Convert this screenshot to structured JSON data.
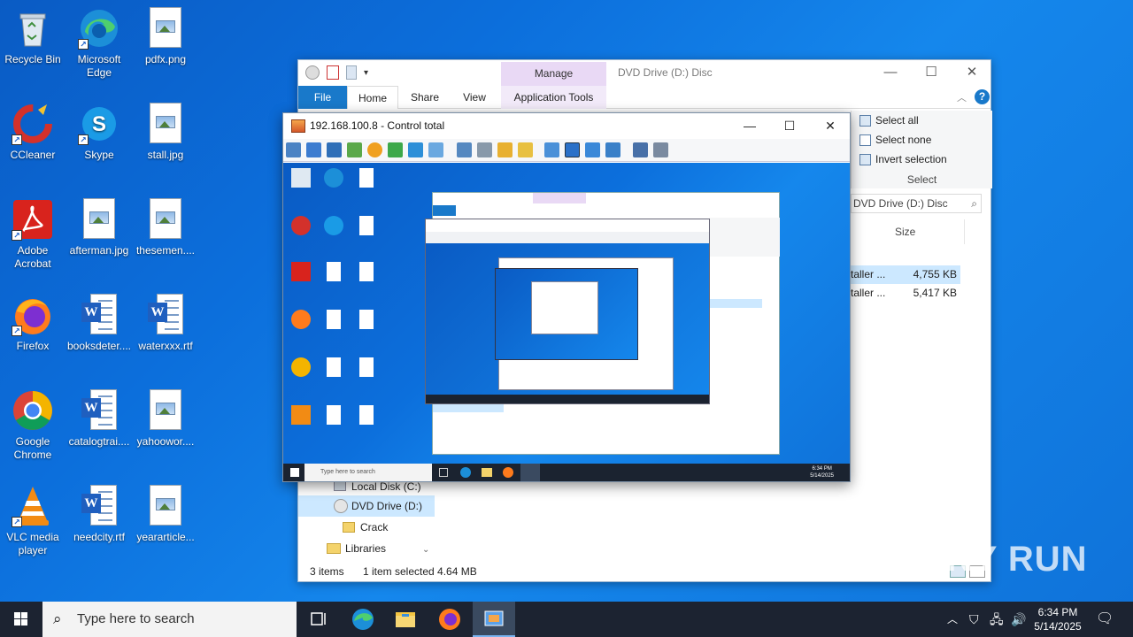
{
  "desktop": {
    "icons": [
      {
        "label": "Recycle Bin",
        "icon": "recycle-bin-icon"
      },
      {
        "label": "Microsoft Edge",
        "icon": "edge-icon"
      },
      {
        "label": "pdfx.png",
        "icon": "image-file-icon"
      },
      {
        "label": "CCleaner",
        "icon": "ccleaner-icon"
      },
      {
        "label": "Skype",
        "icon": "skype-icon"
      },
      {
        "label": "stall.jpg",
        "icon": "image-file-icon"
      },
      {
        "label": "Adobe Acrobat",
        "icon": "acrobat-icon"
      },
      {
        "label": "afterman.jpg",
        "icon": "image-file-icon"
      },
      {
        "label": "thesemen....",
        "icon": "image-file-icon"
      },
      {
        "label": "Firefox",
        "icon": "firefox-icon"
      },
      {
        "label": "booksdeter....",
        "icon": "word-file-icon"
      },
      {
        "label": "waterxxx.rtf",
        "icon": "word-file-icon"
      },
      {
        "label": "Google Chrome",
        "icon": "chrome-icon"
      },
      {
        "label": "catalogtrai....",
        "icon": "word-file-icon"
      },
      {
        "label": "yahoowor....",
        "icon": "image-file-icon"
      },
      {
        "label": "VLC media player",
        "icon": "vlc-icon"
      },
      {
        "label": "needcity.rtf",
        "icon": "word-file-icon"
      },
      {
        "label": "yeararticle...",
        "icon": "image-file-icon"
      }
    ]
  },
  "explorer": {
    "title": "DVD Drive (D:) Disc",
    "manage_label": "Manage",
    "tabs": {
      "file": "File",
      "home": "Home",
      "share": "Share",
      "view": "View",
      "app_tools": "Application Tools"
    },
    "select_group": {
      "select_all": "Select all",
      "select_none": "Select none",
      "invert": "Invert selection",
      "group": "Select"
    },
    "address": "DVD Drive (D:) Disc",
    "size_header": "Size",
    "files": [
      {
        "name": "taller ...",
        "size": "4,755 KB"
      },
      {
        "name": "taller ...",
        "size": "5,417 KB"
      }
    ],
    "nav": [
      {
        "label": "Local Disk (C:)"
      },
      {
        "label": "DVD Drive (D:)"
      },
      {
        "label": "Crack"
      },
      {
        "label": "Libraries"
      }
    ],
    "status": {
      "items": "3 items",
      "selected": "1 item selected  4.64 MB"
    }
  },
  "remote": {
    "title": "192.168.100.8 - Control total",
    "taskbar_search": "Type here to search",
    "time": "6:34 PM",
    "date": "5/14/2025"
  },
  "taskbar": {
    "search_placeholder": "Type here to search",
    "time": "6:34 PM",
    "date": "5/14/2025"
  },
  "watermark": "ANY RUN",
  "colors": {
    "accent": "#1979ca",
    "taskbar": "#1c2331",
    "desktop": "#0c6fdc",
    "manage": "#e9d9f5"
  }
}
